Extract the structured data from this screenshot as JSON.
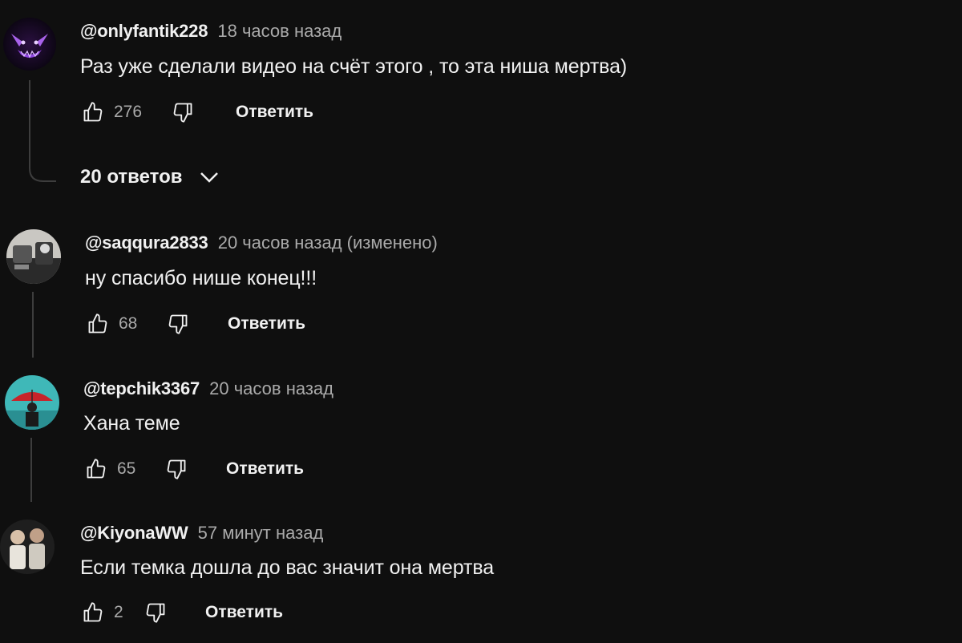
{
  "comments": [
    {
      "author": "@onlyfantik228",
      "time": "18 часов назад",
      "text": "Раз уже сделали видео на счёт этого , то эта ниша мертва)",
      "likes": "276",
      "reply_label": "Ответить"
    },
    {
      "author": "@saqqura2833",
      "time": "20 часов назад (изменено)",
      "text": "ну спасибо нише конец!!!",
      "likes": "68",
      "reply_label": "Ответить"
    },
    {
      "author": "@tepchik3367",
      "time": "20 часов назад",
      "text": "Хана теме",
      "likes": "65",
      "reply_label": "Ответить"
    },
    {
      "author": "@KiyonaWW",
      "time": "57 минут назад",
      "text": "Если темка дошла до вас значит она мертва",
      "likes": "2",
      "reply_label": "Ответить"
    }
  ],
  "replies_toggle": {
    "label": "20 ответов",
    "icon": "chevron-down-icon"
  },
  "colors": {
    "background": "#0f0f0f",
    "text_primary": "#f1f1f1",
    "text_secondary": "#aaaaaa",
    "thread_line": "#3d3d3d"
  }
}
